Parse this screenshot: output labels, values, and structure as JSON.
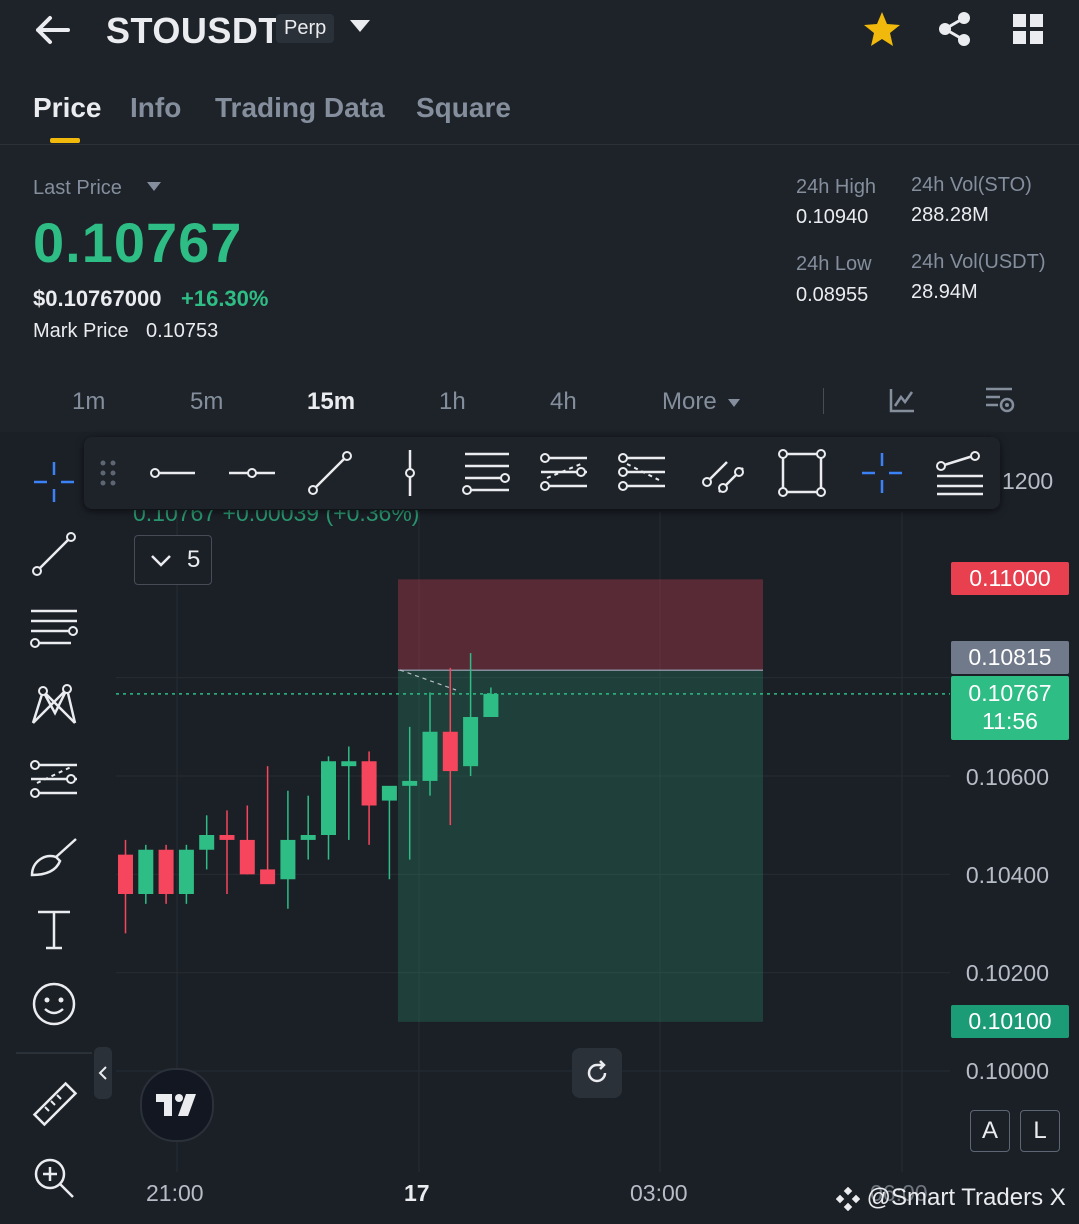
{
  "header": {
    "back_icon": "arrow-left-icon",
    "symbol": "STOUSDT",
    "badge": "Perp",
    "dropdown_icon": "caret-down-icon",
    "star_icon": "star-icon",
    "share_icon": "share-icon",
    "grid_icon": "grid-icon",
    "star_color": "#f0b90b"
  },
  "tabs": [
    {
      "label": "Price",
      "active": true
    },
    {
      "label": "Info",
      "active": false
    },
    {
      "label": "Trading Data",
      "active": false
    },
    {
      "label": "Square",
      "active": false
    }
  ],
  "price": {
    "last_price_label": "Last Price",
    "last_price": "0.10767",
    "usd_price": "$0.10767000",
    "change_pct": "+16.30%",
    "mark_price_label": "Mark Price",
    "mark_price": "0.10753"
  },
  "stats": {
    "high_label": "24h High",
    "high": "0.10940",
    "low_label": "24h Low",
    "low": "0.08955",
    "vol_sto_label": "24h Vol(STO)",
    "vol_sto": "288.28M",
    "vol_usdt_label": "24h Vol(USDT)",
    "vol_usdt": "28.94M"
  },
  "intervals": [
    {
      "label": "1m",
      "active": false
    },
    {
      "label": "5m",
      "active": false
    },
    {
      "label": "15m",
      "active": true
    },
    {
      "label": "1h",
      "active": false
    },
    {
      "label": "4h",
      "active": false
    },
    {
      "label": "More",
      "active": false
    }
  ],
  "chart": {
    "overlay_text": "0.10767  +0.00039 (+0.36%)",
    "indicator_count": "5",
    "top_axis_partial": "1200",
    "price_axis": [
      "0.10600",
      "0.10400",
      "0.10200",
      "0.10000"
    ],
    "tags": {
      "stop": "0.11000",
      "entry": "0.10815",
      "current": "0.10767",
      "countdown": "11:56",
      "target": "0.10100"
    },
    "time_axis": [
      "21:00",
      "17",
      "03:00",
      "06:00"
    ],
    "colors": {
      "up": "#2ebd85",
      "down": "#f6465d",
      "stop_tag": "#e8404f",
      "entry_tag": "#707a8a",
      "target_tag": "#1b9c77"
    },
    "watermark": "@Smart Traders X",
    "auto_label": "A",
    "log_label": "L",
    "logo_label": "TradingView logo",
    "candles": [
      {
        "o": 0.1044,
        "h": 0.1047,
        "l": 0.1028,
        "c": 0.1036
      },
      {
        "o": 0.1036,
        "h": 0.1046,
        "l": 0.1034,
        "c": 0.1045
      },
      {
        "o": 0.1045,
        "h": 0.1046,
        "l": 0.1034,
        "c": 0.1036
      },
      {
        "o": 0.1036,
        "h": 0.1046,
        "l": 0.1034,
        "c": 0.1045
      },
      {
        "o": 0.1045,
        "h": 0.1052,
        "l": 0.1041,
        "c": 0.1048
      },
      {
        "o": 0.1048,
        "h": 0.1053,
        "l": 0.1036,
        "c": 0.1047
      },
      {
        "o": 0.1047,
        "h": 0.1054,
        "l": 0.104,
        "c": 0.104
      },
      {
        "o": 0.1041,
        "h": 0.1062,
        "l": 0.104,
        "c": 0.1038
      },
      {
        "o": 0.1039,
        "h": 0.1057,
        "l": 0.1033,
        "c": 0.1047
      },
      {
        "o": 0.1047,
        "h": 0.1056,
        "l": 0.1043,
        "c": 0.1048
      },
      {
        "o": 0.1048,
        "h": 0.1064,
        "l": 0.1043,
        "c": 0.1063
      },
      {
        "o": 0.1062,
        "h": 0.1066,
        "l": 0.1047,
        "c": 0.1063
      },
      {
        "o": 0.1063,
        "h": 0.1065,
        "l": 0.1046,
        "c": 0.1054
      },
      {
        "o": 0.1055,
        "h": 0.1056,
        "l": 0.1039,
        "c": 0.1058
      },
      {
        "o": 0.1058,
        "h": 0.107,
        "l": 0.1043,
        "c": 0.1059
      },
      {
        "o": 0.1059,
        "h": 0.1077,
        "l": 0.1056,
        "c": 0.1069
      },
      {
        "o": 0.1069,
        "h": 0.1082,
        "l": 0.105,
        "c": 0.1061
      },
      {
        "o": 0.1062,
        "h": 0.1085,
        "l": 0.106,
        "c": 0.1072
      },
      {
        "o": 0.1072,
        "h": 0.1078,
        "l": 0.1073,
        "c": 0.10767
      }
    ]
  },
  "toolbar_icons": [
    "drag-handle-icon",
    "horizontal-ray-icon",
    "horizontal-line-icon",
    "trend-line-icon",
    "vertical-line-icon",
    "parallel-channel-icon",
    "fib-retracement-icon",
    "fib-extension-icon",
    "trend-angle-icon",
    "rectangle-icon",
    "crosshair-icon",
    "fib-fan-icon"
  ],
  "left_tools": [
    "crosshair-icon",
    "trend-line-icon",
    "horizontal-lines-icon",
    "pattern-icon",
    "fib-icon",
    "brush-icon",
    "text-icon",
    "emoji-icon",
    "ruler-icon",
    "zoom-in-icon"
  ]
}
